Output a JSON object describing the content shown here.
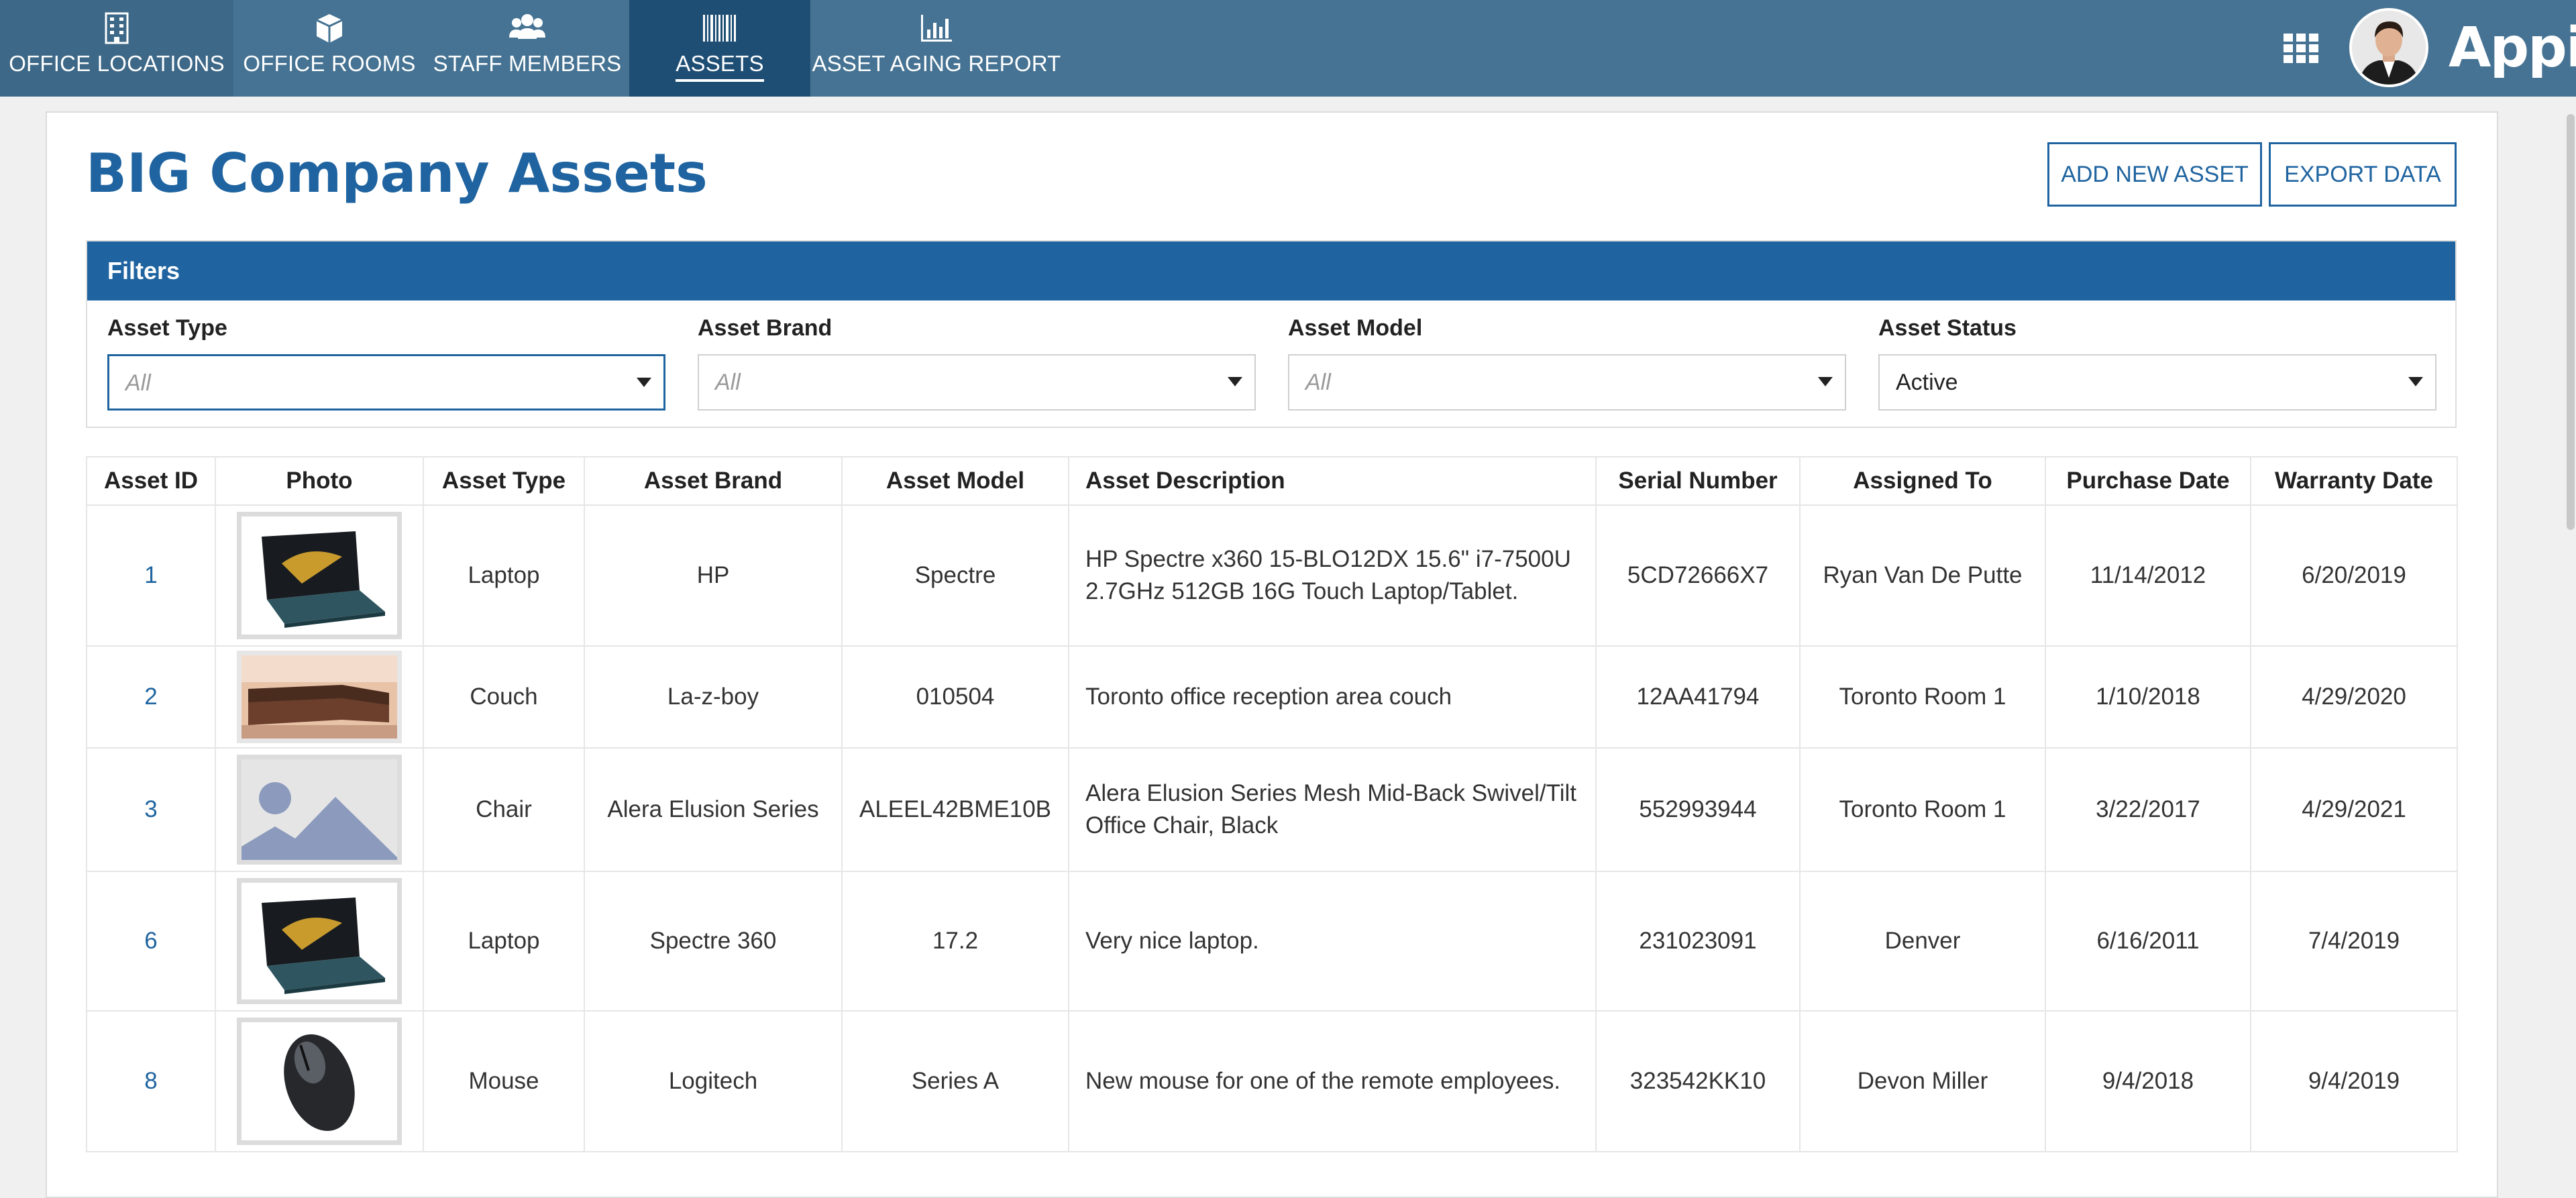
{
  "nav": {
    "tabs": [
      {
        "label": "OFFICE LOCATIONS",
        "icon": "building-icon"
      },
      {
        "label": "OFFICE ROOMS",
        "icon": "cube-icon"
      },
      {
        "label": "STAFF MEMBERS",
        "icon": "users-icon"
      },
      {
        "label": "ASSETS",
        "icon": "barcode-icon",
        "active": true
      },
      {
        "label": "ASSET AGING REPORT",
        "icon": "bar-chart-icon"
      }
    ],
    "brand": "Appian",
    "colors": {
      "bar": "#467393",
      "active_tab": "#1f4e75",
      "first_tab": "#3d6887",
      "accent": "#1f64a0"
    }
  },
  "page": {
    "title": "BIG Company Assets",
    "add_button": "ADD NEW ASSET",
    "export_button": "EXPORT DATA"
  },
  "filters": {
    "header": "Filters",
    "fields": [
      {
        "label": "Asset Type",
        "value": "All",
        "placeholder": true
      },
      {
        "label": "Asset Brand",
        "value": "All",
        "placeholder": true
      },
      {
        "label": "Asset Model",
        "value": "All",
        "placeholder": true
      },
      {
        "label": "Asset Status",
        "value": "Active",
        "placeholder": false
      }
    ]
  },
  "table": {
    "columns": [
      "Asset ID",
      "Photo",
      "Asset Type",
      "Asset Brand",
      "Asset Model",
      "Asset Description",
      "Serial Number",
      "Assigned To",
      "Purchase Date",
      "Warranty Date"
    ],
    "rows": [
      {
        "id": "1",
        "photo": "laptop",
        "type": "Laptop",
        "brand": "HP",
        "model": "Spectre",
        "description": "HP Spectre x360 15-BLO12DX 15.6\" i7-7500U 2.7GHz 512GB 16G Touch Laptop/Tablet.",
        "serial": "5CD72666X7",
        "assigned": "Ryan Van De Putte",
        "purchase": "11/14/2012",
        "warranty": "6/20/2019"
      },
      {
        "id": "2",
        "photo": "couch",
        "type": "Couch",
        "brand": "La-z-boy",
        "model": "010504",
        "description": "Toronto office reception area couch",
        "serial": "12AA41794",
        "assigned": "Toronto Room 1",
        "purchase": "1/10/2018",
        "warranty": "4/29/2020"
      },
      {
        "id": "3",
        "photo": "placeholder",
        "type": "Chair",
        "brand": "Alera Elusion Series",
        "model": "ALEEL42BME10B",
        "description": "Alera Elusion Series Mesh Mid-Back Swivel/Tilt Office Chair, Black",
        "serial": "552993944",
        "assigned": "Toronto Room 1",
        "purchase": "3/22/2017",
        "warranty": "4/29/2021"
      },
      {
        "id": "6",
        "photo": "laptop",
        "type": "Laptop",
        "brand": "Spectre 360",
        "model": "17.2",
        "description": "Very nice laptop.",
        "serial": "231023091",
        "assigned": "Denver",
        "purchase": "6/16/2011",
        "warranty": "7/4/2019"
      },
      {
        "id": "8",
        "photo": "mouse",
        "type": "Mouse",
        "brand": "Logitech",
        "model": "Series A",
        "description": "New mouse for one of the remote employees.",
        "serial": "323542KK10",
        "assigned": "Devon Miller",
        "purchase": "9/4/2018",
        "warranty": "9/4/2019"
      }
    ]
  }
}
